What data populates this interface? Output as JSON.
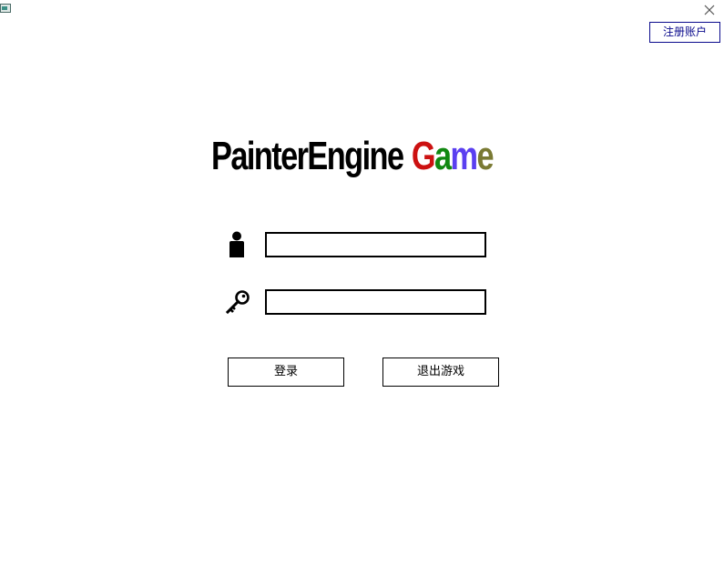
{
  "window": {
    "icon": "app-window-icon",
    "close_icon": "close-icon"
  },
  "header": {
    "register_label": "注册账户"
  },
  "logo": {
    "part1": "PainterEngine",
    "part2_letters": [
      {
        "char": "G",
        "color": "#cc1111"
      },
      {
        "char": "a",
        "color": "#118811"
      },
      {
        "char": "m",
        "color": "#5a3ff0"
      },
      {
        "char": "e",
        "color": "#7a7a33"
      }
    ]
  },
  "form": {
    "username_icon": "user-icon",
    "password_icon": "key-icon",
    "username_value": "",
    "password_value": ""
  },
  "actions": {
    "login_label": "登录",
    "exit_label": "退出游戏"
  }
}
